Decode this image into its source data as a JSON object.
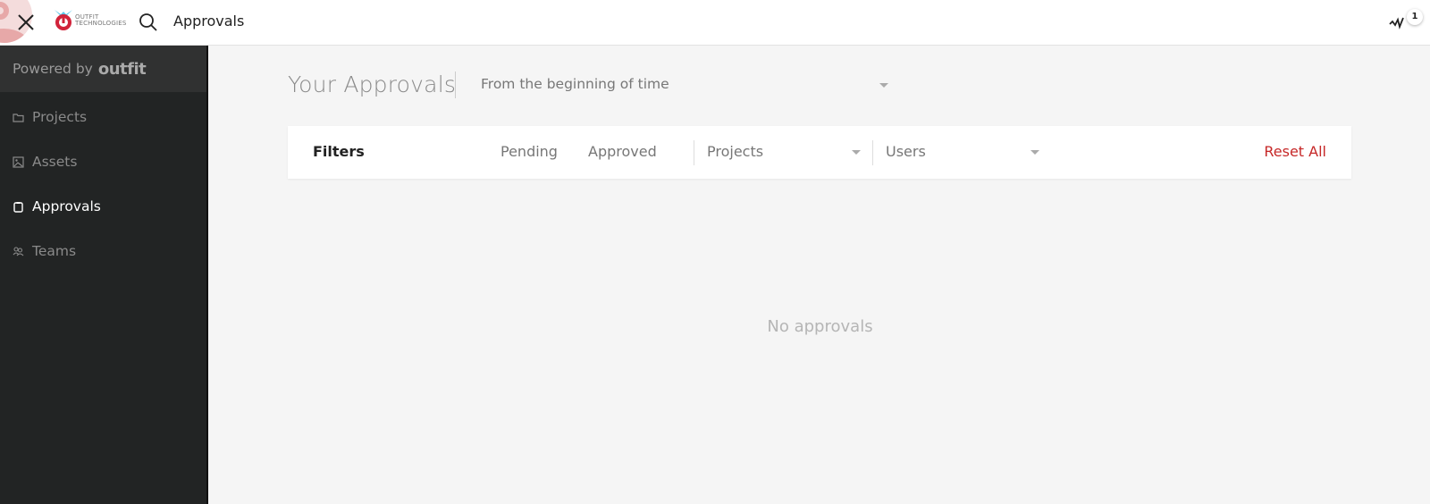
{
  "topbar": {
    "logo_text_line1": "OUTFIT",
    "logo_text_line2": "TECHNOLOGIES",
    "title": "Approvals",
    "notification_count": "1",
    "icons": [
      "close-icon",
      "search-icon",
      "activity-icon"
    ]
  },
  "sidebar": {
    "powered_by": "Powered by",
    "powered_brand": "outfit",
    "items": [
      {
        "label": "Projects",
        "icon": "folder-icon",
        "active": false
      },
      {
        "label": "Assets",
        "icon": "image-icon",
        "active": false
      },
      {
        "label": "Approvals",
        "icon": "clipboard-icon",
        "active": true
      },
      {
        "label": "Teams",
        "icon": "team-icon",
        "active": false
      }
    ]
  },
  "main": {
    "title": "Your Approvals",
    "time_range": "From the beginning of time",
    "filters": {
      "label": "Filters",
      "tabs": [
        "Pending",
        "Approved"
      ],
      "projects_select": "Projects",
      "users_select": "Users",
      "reset_label": "Reset All"
    },
    "empty_message": "No approvals"
  },
  "colors": {
    "accent_red": "#c62828",
    "sidebar_bg": "#222424",
    "sidebar_header_bg": "#303131",
    "content_bg": "#f5f5f5"
  }
}
